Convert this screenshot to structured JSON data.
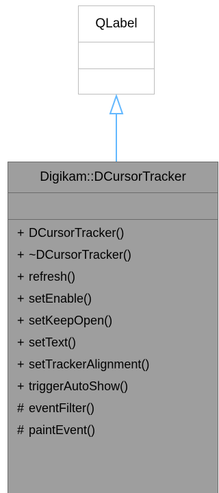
{
  "base_class": {
    "name": "QLabel"
  },
  "derived_class": {
    "name": "Digikam::DCursorTracker",
    "members": [
      {
        "visibility": "+",
        "signature": "DCursorTracker()"
      },
      {
        "visibility": "+",
        "signature": "~DCursorTracker()"
      },
      {
        "visibility": "+",
        "signature": "refresh()"
      },
      {
        "visibility": "+",
        "signature": "setEnable()"
      },
      {
        "visibility": "+",
        "signature": "setKeepOpen()"
      },
      {
        "visibility": "+",
        "signature": "setText()"
      },
      {
        "visibility": "+",
        "signature": "setTrackerAlignment()"
      },
      {
        "visibility": "+",
        "signature": "triggerAutoShow()"
      },
      {
        "visibility": "#",
        "signature": "eventFilter()"
      },
      {
        "visibility": "#",
        "signature": "paintEvent()"
      }
    ]
  },
  "colors": {
    "arrow": "#63b8ff",
    "derived_fill": "#9e9e9e",
    "base_border": "#bdbdbd"
  }
}
